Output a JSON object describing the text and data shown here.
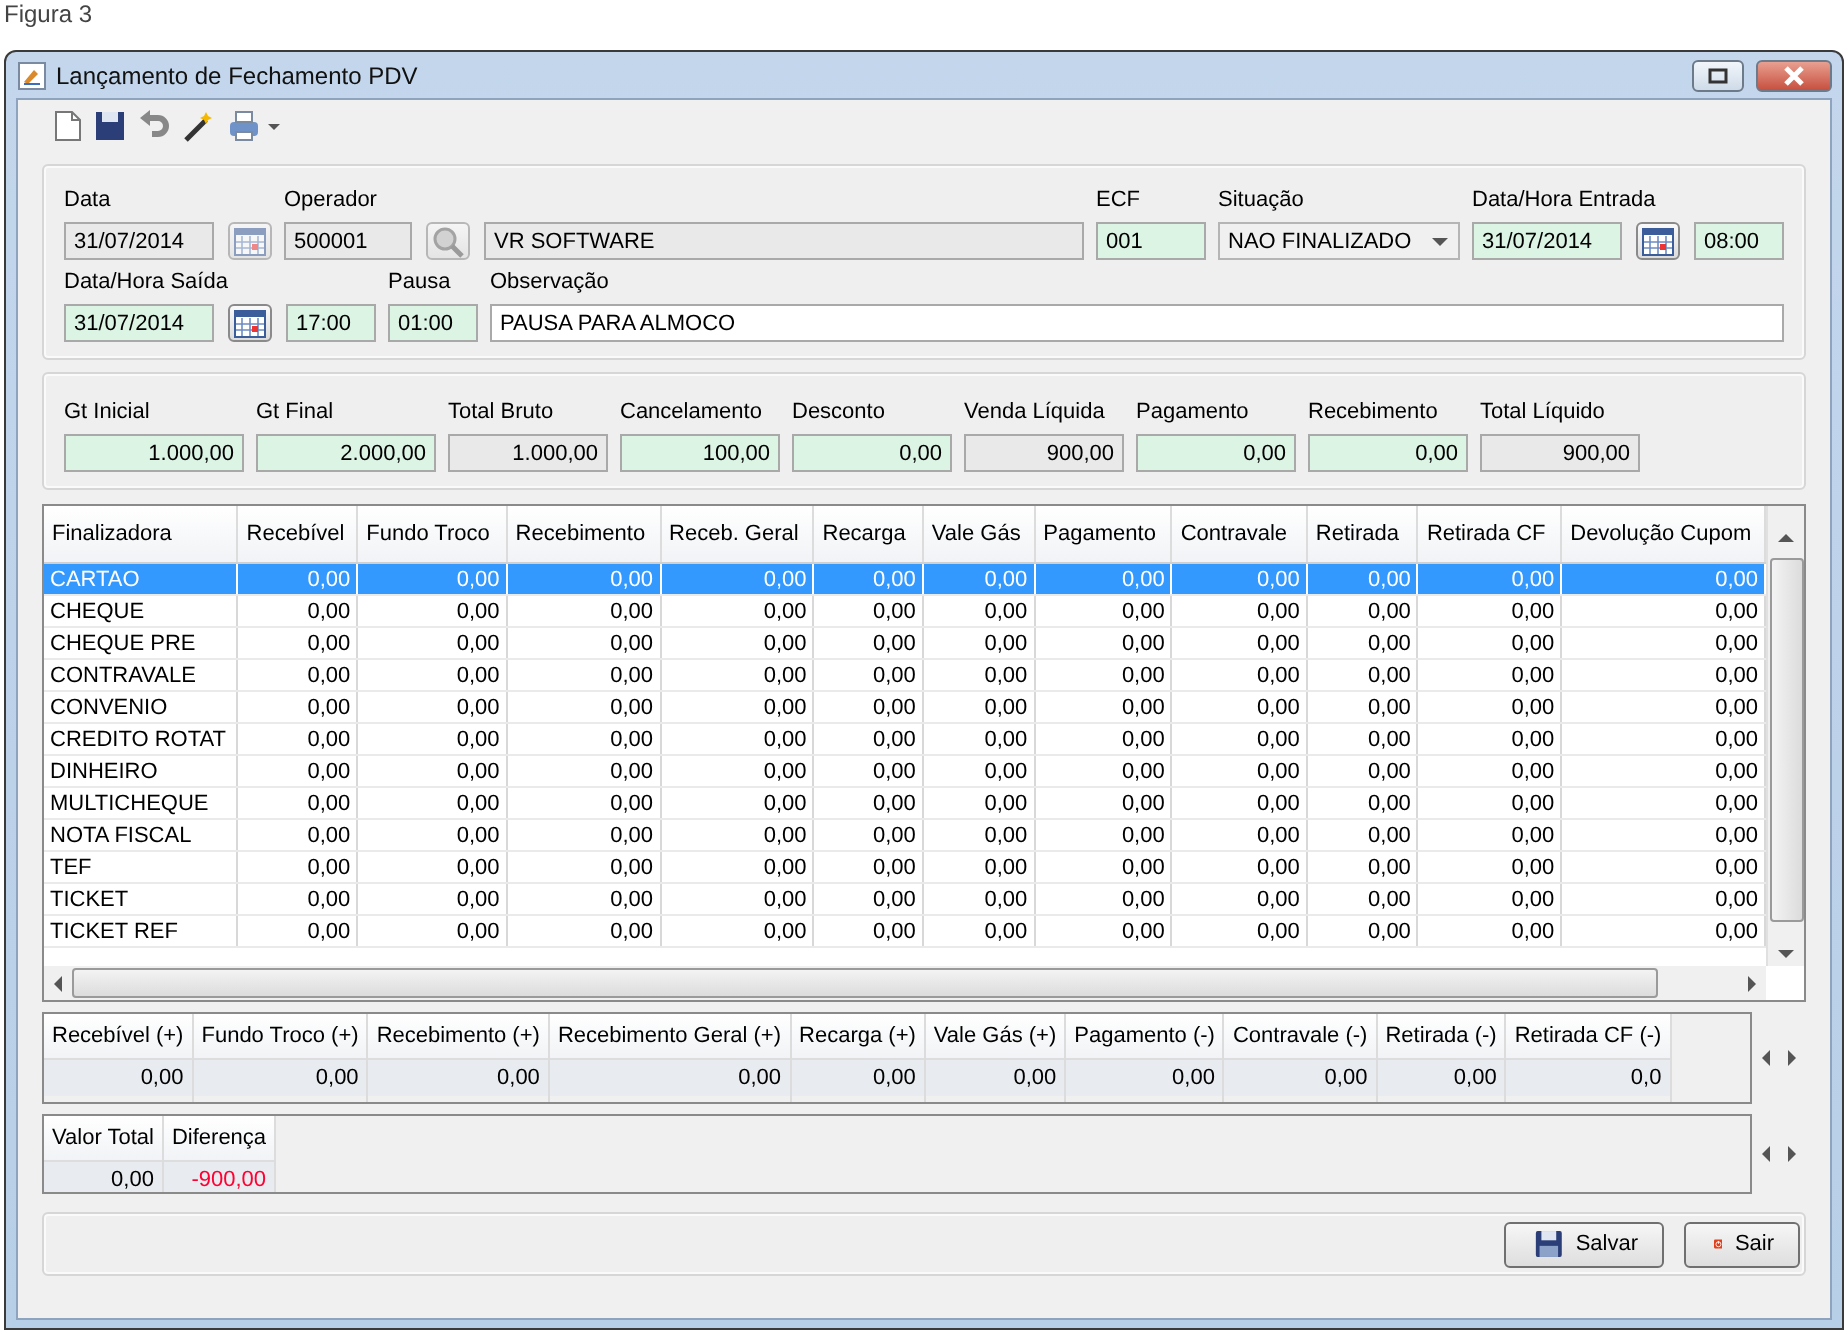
{
  "caption": "Figura 3",
  "window": {
    "title": "Lançamento de Fechamento PDV"
  },
  "form": [
    [
      {
        "label": "Data",
        "parts": [
          {
            "kind": "date",
            "value": "31/07/2014",
            "editable": false
          },
          {
            "kind": "calendar",
            "disabled": true
          }
        ]
      },
      {
        "label": "Operador",
        "parts": [
          {
            "kind": "code",
            "value": "500001",
            "editable": false
          },
          {
            "kind": "search",
            "disabled": true
          },
          {
            "kind": "name",
            "value": "VR SOFTWARE",
            "editable": false
          }
        ]
      },
      {
        "label": "ECF",
        "parts": [
          {
            "kind": "short",
            "value": "001",
            "editable": true,
            "required": true
          }
        ]
      },
      {
        "label": "Situação",
        "parts": [
          {
            "kind": "select",
            "value": "NAO FINALIZADO",
            "disabled": true
          }
        ]
      },
      {
        "label": "Data/Hora Entrada",
        "parts": [
          {
            "kind": "date",
            "value": "31/07/2014",
            "editable": true,
            "required": true
          },
          {
            "kind": "calendar",
            "disabled": false
          },
          {
            "kind": "time",
            "value": "08:00",
            "editable": true,
            "required": true
          }
        ]
      }
    ],
    [
      {
        "label": "Data/Hora Saída",
        "parts": [
          {
            "kind": "date",
            "value": "31/07/2014",
            "editable": true,
            "required": true
          },
          {
            "kind": "calendar",
            "disabled": false
          },
          {
            "kind": "time",
            "value": "17:00",
            "editable": true,
            "required": true
          }
        ]
      },
      {
        "label": "Pausa",
        "parts": [
          {
            "kind": "time",
            "value": "01:00",
            "editable": true,
            "required": true
          }
        ]
      },
      {
        "label": "Observação",
        "parts": [
          {
            "kind": "name",
            "value": "PAUSA PARA ALMOCO",
            "editable": true,
            "required": false
          }
        ]
      }
    ]
  ],
  "totals": [
    {
      "label": "Gt Inicial",
      "value": "1.000,00",
      "editable": true
    },
    {
      "label": "Gt Final",
      "value": "2.000,00",
      "editable": true
    },
    {
      "label": "Total Bruto",
      "value": "1.000,00",
      "editable": false
    },
    {
      "label": "Cancelamento",
      "value": "100,00",
      "editable": true
    },
    {
      "label": "Desconto",
      "value": "0,00",
      "editable": true
    },
    {
      "label": "Venda Líquida",
      "value": "900,00",
      "editable": false
    },
    {
      "label": "Pagamento",
      "value": "0,00",
      "editable": true
    },
    {
      "label": "Recebimento",
      "value": "0,00",
      "editable": true
    },
    {
      "label": "Total Líquido",
      "value": "900,00",
      "editable": false
    }
  ],
  "grid": {
    "columns": [
      "Finalizadora",
      "Recebível",
      "Fundo Troco",
      "Recebimento",
      "Receb. Geral",
      "Recarga",
      "Vale Gás",
      "Pagamento",
      "Contravale",
      "Retirada",
      "Retirada CF",
      "Devolução Cupom"
    ],
    "rows": [
      {
        "selected": true,
        "cells": [
          "CARTAO",
          "0,00",
          "0,00",
          "0,00",
          "0,00",
          "0,00",
          "0,00",
          "0,00",
          "0,00",
          "0,00",
          "0,00",
          "0,00"
        ]
      },
      {
        "selected": false,
        "cells": [
          "CHEQUE",
          "0,00",
          "0,00",
          "0,00",
          "0,00",
          "0,00",
          "0,00",
          "0,00",
          "0,00",
          "0,00",
          "0,00",
          "0,00"
        ]
      },
      {
        "selected": false,
        "cells": [
          "CHEQUE PRE",
          "0,00",
          "0,00",
          "0,00",
          "0,00",
          "0,00",
          "0,00",
          "0,00",
          "0,00",
          "0,00",
          "0,00",
          "0,00"
        ]
      },
      {
        "selected": false,
        "cells": [
          "CONTRAVALE",
          "0,00",
          "0,00",
          "0,00",
          "0,00",
          "0,00",
          "0,00",
          "0,00",
          "0,00",
          "0,00",
          "0,00",
          "0,00"
        ]
      },
      {
        "selected": false,
        "cells": [
          "CONVENIO",
          "0,00",
          "0,00",
          "0,00",
          "0,00",
          "0,00",
          "0,00",
          "0,00",
          "0,00",
          "0,00",
          "0,00",
          "0,00"
        ]
      },
      {
        "selected": false,
        "cells": [
          "CREDITO ROTAT",
          "0,00",
          "0,00",
          "0,00",
          "0,00",
          "0,00",
          "0,00",
          "0,00",
          "0,00",
          "0,00",
          "0,00",
          "0,00"
        ]
      },
      {
        "selected": false,
        "cells": [
          "DINHEIRO",
          "0,00",
          "0,00",
          "0,00",
          "0,00",
          "0,00",
          "0,00",
          "0,00",
          "0,00",
          "0,00",
          "0,00",
          "0,00"
        ]
      },
      {
        "selected": false,
        "cells": [
          "MULTICHEQUE",
          "0,00",
          "0,00",
          "0,00",
          "0,00",
          "0,00",
          "0,00",
          "0,00",
          "0,00",
          "0,00",
          "0,00",
          "0,00"
        ]
      },
      {
        "selected": false,
        "cells": [
          "NOTA FISCAL",
          "0,00",
          "0,00",
          "0,00",
          "0,00",
          "0,00",
          "0,00",
          "0,00",
          "0,00",
          "0,00",
          "0,00",
          "0,00"
        ]
      },
      {
        "selected": false,
        "cells": [
          "TEF",
          "0,00",
          "0,00",
          "0,00",
          "0,00",
          "0,00",
          "0,00",
          "0,00",
          "0,00",
          "0,00",
          "0,00",
          "0,00"
        ]
      },
      {
        "selected": false,
        "cells": [
          "TICKET",
          "0,00",
          "0,00",
          "0,00",
          "0,00",
          "0,00",
          "0,00",
          "0,00",
          "0,00",
          "0,00",
          "0,00",
          "0,00"
        ]
      },
      {
        "selected": false,
        "cells": [
          "TICKET REF",
          "0,00",
          "0,00",
          "0,00",
          "0,00",
          "0,00",
          "0,00",
          "0,00",
          "0,00",
          "0,00",
          "0,00",
          "0,00"
        ]
      }
    ]
  },
  "summary": [
    {
      "label": "Recebível (+)",
      "value": "0,00"
    },
    {
      "label": "Fundo Troco (+)",
      "value": "0,00"
    },
    {
      "label": "Recebimento (+)",
      "value": "0,00"
    },
    {
      "label": "Recebimento Geral (+)",
      "value": "0,00"
    },
    {
      "label": "Recarga (+)",
      "value": "0,00"
    },
    {
      "label": "Vale Gás (+)",
      "value": "0,00"
    },
    {
      "label": "Pagamento (-)",
      "value": "0,00"
    },
    {
      "label": "Contravale (-)",
      "value": "0,00"
    },
    {
      "label": "Retirada (-)",
      "value": "0,00"
    },
    {
      "label": "Retirada CF (-)",
      "value": "0,0"
    }
  ],
  "difference": [
    {
      "label": "Valor Total",
      "value": "0,00",
      "negative": false
    },
    {
      "label": "Diferença",
      "value": "-900,00",
      "negative": true
    }
  ],
  "buttons": [
    {
      "label": "Salvar",
      "kind": "save"
    },
    {
      "label": "Sair",
      "kind": "exit"
    }
  ]
}
